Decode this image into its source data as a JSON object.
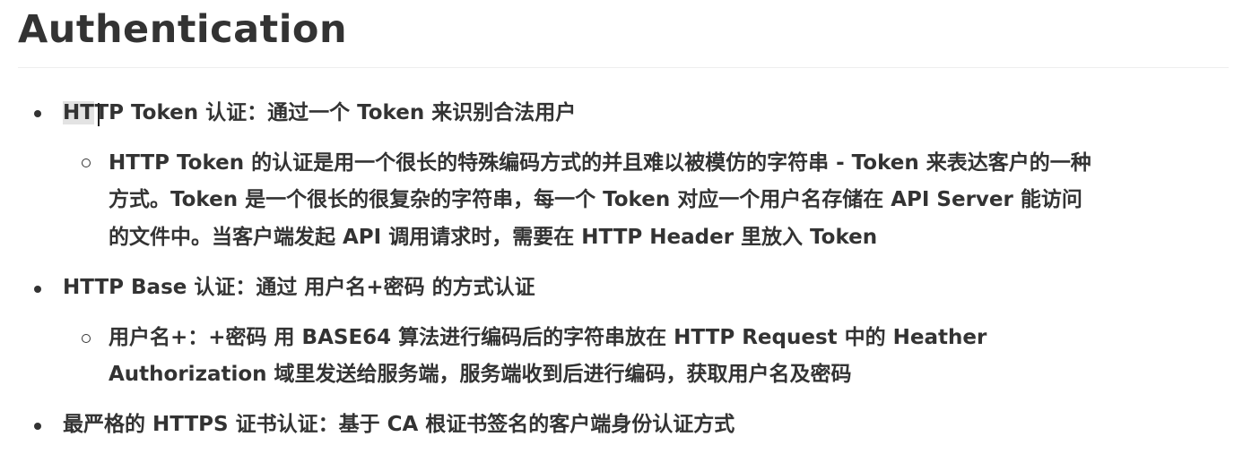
{
  "heading": "Authentication",
  "items": [
    {
      "label_highlight": "HT",
      "label_rest": "TP Token 认证：通过一个 Token 来识别合法用户",
      "sub": [
        "HTTP Token 的认证是用一个很长的特殊编码方式的并且难以被模仿的字符串 - Token 来表达客户的一种",
        "方式。Token 是一个很长的很复杂的字符串，每一个 Token 对应一个用户名存储在 API Server 能访问",
        "的文件中。当客户端发起 API 调用请求时，需要在 HTTP Header 里放入 Token"
      ]
    },
    {
      "label": "HTTP Base 认证：通过 用户名+密码 的方式认证",
      "sub": [
        "用户名+：+密码 用 BASE64 算法进行编码后的字符串放在 HTTP Request 中的 Heather",
        "Authorization 域里发送给服务端，服务端收到后进行编码，获取用户名及密码"
      ]
    },
    {
      "label": "最严格的 HTTPS 证书认证：基于 CA 根证书签名的客户端身份认证方式"
    }
  ]
}
